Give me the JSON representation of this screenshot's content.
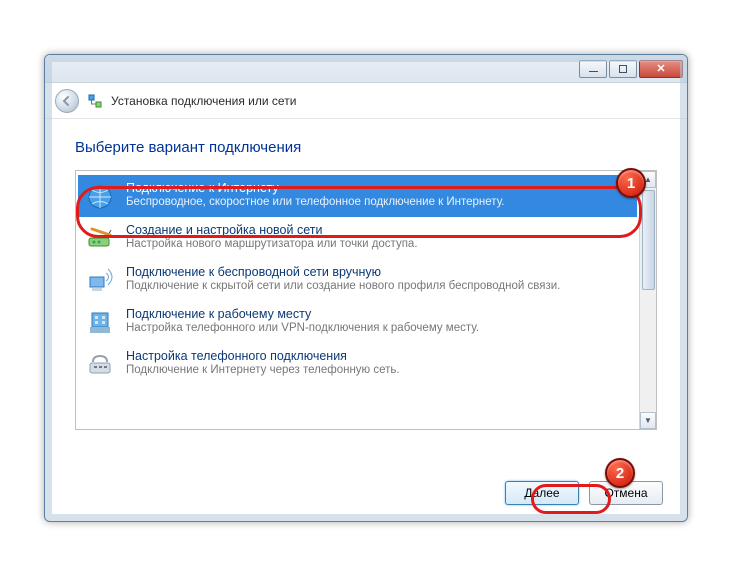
{
  "header": {
    "title": "Установка подключения или сети"
  },
  "instruction": "Выберите вариант подключения",
  "options": [
    {
      "title": "Подключение к Интернету",
      "desc": "Беспроводное, скоростное или телефонное подключение к Интернету.",
      "icon": "globe-icon",
      "selected": true
    },
    {
      "title": "Создание и настройка новой сети",
      "desc": "Настройка нового маршрутизатора или точки доступа.",
      "icon": "router-icon",
      "selected": false
    },
    {
      "title": "Подключение к беспроводной сети вручную",
      "desc": "Подключение к скрытой сети или создание нового профиля беспроводной связи.",
      "icon": "wireless-icon",
      "selected": false
    },
    {
      "title": "Подключение к рабочему месту",
      "desc": "Настройка телефонного или VPN-подключения к рабочему месту.",
      "icon": "workplace-icon",
      "selected": false
    },
    {
      "title": "Настройка телефонного подключения",
      "desc": "Подключение к Интернету через телефонную сеть.",
      "icon": "dialup-icon",
      "selected": false
    }
  ],
  "buttons": {
    "next": "Далее",
    "cancel": "Отмена"
  },
  "callouts": {
    "1": "1",
    "2": "2"
  }
}
